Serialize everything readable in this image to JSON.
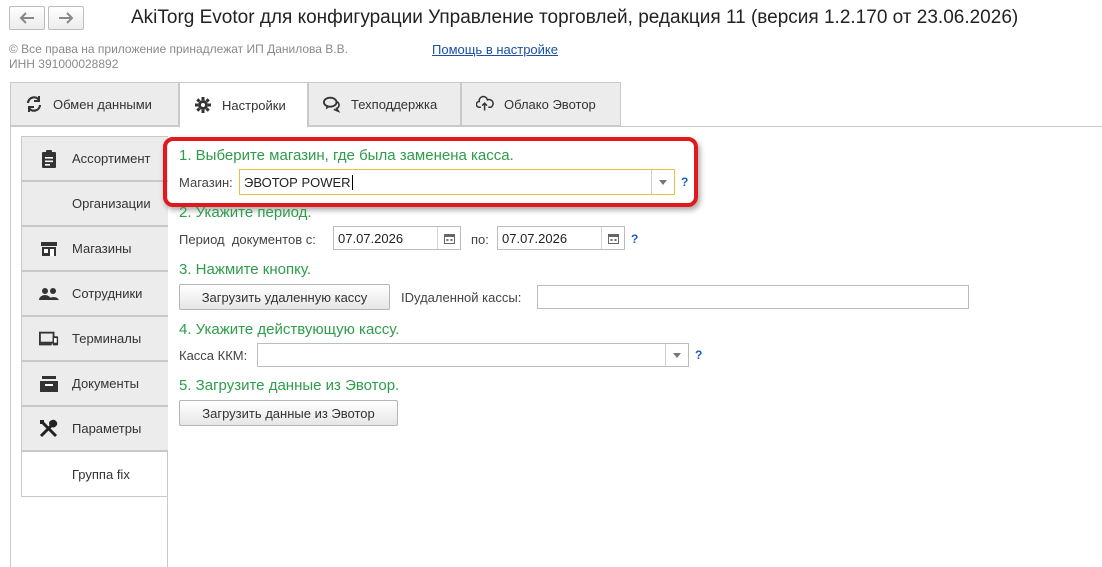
{
  "window": {
    "title": "AkiTorg Evotor для конфигурации Управление торговлей, редакция 11 (версия 1.2.170 от 23.06.2026)",
    "copyright_line1": "© Все права на приложение принадлежат ИП Данилова В.В.",
    "copyright_line2": "ИНН 391000028892",
    "help_link": "Помощь в настройке",
    "nav": {
      "back_icon": "arrow-left-icon",
      "forward_icon": "arrow-right-icon"
    }
  },
  "tabs": [
    {
      "label": "Обмен данными",
      "icon": "refresh-icon"
    },
    {
      "label": "Настройки",
      "icon": "gear-icon",
      "active": true
    },
    {
      "label": "Техподдержка",
      "icon": "chat-icon"
    },
    {
      "label": "Облако Эвотор",
      "icon": "cloud-icon"
    }
  ],
  "sidebar": [
    {
      "label": "Ассортимент",
      "icon": "clipboard-icon"
    },
    {
      "label": "Организации",
      "icon": ""
    },
    {
      "label": "Магазины",
      "icon": "store-icon"
    },
    {
      "label": "Сотрудники",
      "icon": "people-icon"
    },
    {
      "label": "Терминалы",
      "icon": "devices-icon"
    },
    {
      "label": "Документы",
      "icon": "inbox-icon"
    },
    {
      "label": "Параметры",
      "icon": "tools-icon"
    },
    {
      "label": "Группа fix",
      "icon": "",
      "active": true
    }
  ],
  "form": {
    "step1": {
      "title": "1. Выберите магазин, где была заменена касса.",
      "label": "Магазин:",
      "value": "ЭВОТОР POWER",
      "help": "?"
    },
    "step2": {
      "title": "2. Укажите период.",
      "label": "Период  документов с:",
      "from": "07.07.2026",
      "to_label": "по:",
      "to": "07.07.2026",
      "help": "?"
    },
    "step3": {
      "title": "3. Нажмите кнопку.",
      "button": "Загрузить удаленную кассу",
      "id_label": "IDудаленной кассы:",
      "id_value": ""
    },
    "step4": {
      "title": "4. Укажите действующую кассу.",
      "label": "Касса ККМ:",
      "value": "",
      "help": "?"
    },
    "step5": {
      "title": "5. Загрузите данные из Эвотор.",
      "button": "Загрузить данные из Эвотор"
    }
  },
  "colors": {
    "step_green": "#2e9d4a",
    "highlight_red": "#e0191f",
    "focus_yellow": "#e8c23a",
    "link_blue": "#1a4fa5"
  }
}
